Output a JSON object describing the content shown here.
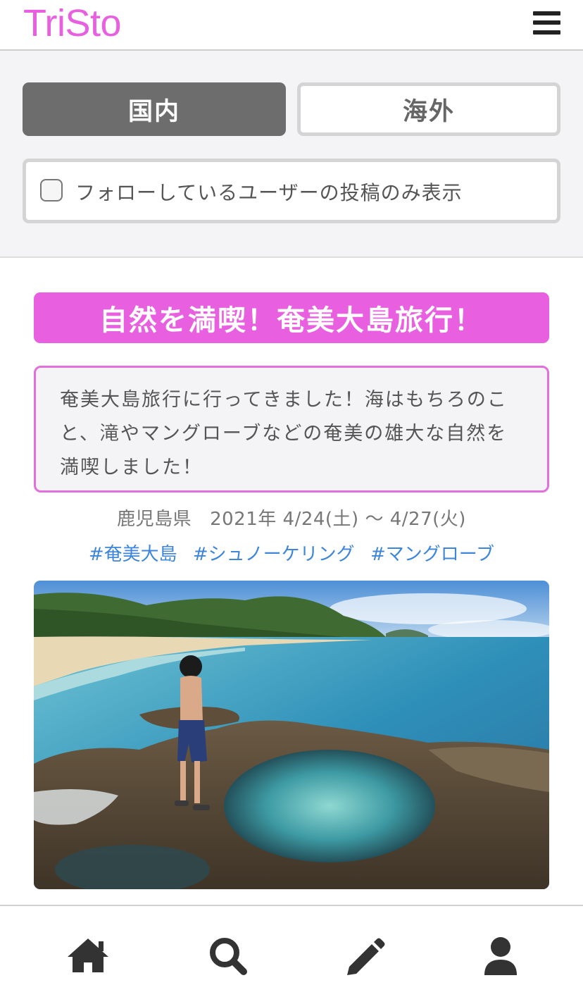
{
  "header": {
    "logo": "TriSto",
    "menu_icon": "hamburger-menu-icon"
  },
  "filter": {
    "tabs": [
      {
        "label": "国内",
        "active": true
      },
      {
        "label": "海外",
        "active": false
      }
    ],
    "follow_only_label": "フォローしているユーザーの投稿のみ表示",
    "follow_only_checked": false
  },
  "post": {
    "title": "自然を満喫！奄美大島旅行！",
    "body": "奄美大島旅行に行ってきました！海はもちろのこと、滝やマングローブなどの奄美の雄大な自然を満喫しました！",
    "prefecture": "鹿児島県",
    "dates": "2021年 4/24(土) 〜 4/27(火)",
    "tags": [
      "#奄美大島",
      "#シュノーケリング",
      "#マングローブ"
    ],
    "photo": "photo of a man standing on coastal rocks beside a tide pool"
  },
  "bottom_nav": [
    {
      "icon": "home-icon"
    },
    {
      "icon": "search-icon"
    },
    {
      "icon": "pencil-icon"
    },
    {
      "icon": "user-icon"
    }
  ],
  "colors": {
    "brand": "#e85fe0",
    "tag": "#3e86d9",
    "tab_active": "#6d6d6d"
  }
}
